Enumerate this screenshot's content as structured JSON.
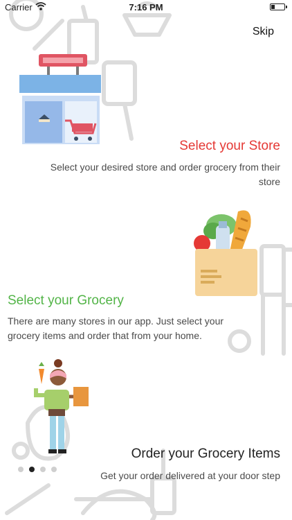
{
  "status_bar": {
    "carrier": "Carrier",
    "time": "7:16 PM",
    "wifi_icon": "wifi-icon",
    "battery_icon": "battery-icon"
  },
  "skip_label": "Skip",
  "sections": [
    {
      "title": "Select your Store",
      "description": "Select your desired store and order grocery from their store",
      "illustration": "store-illustration",
      "title_color": "#e53935"
    },
    {
      "title": "Select your Grocery",
      "description": "There are many stores in our app. Just select your grocery items and order that from your home.",
      "illustration": "grocery-bag-illustration",
      "title_color": "#52b447"
    },
    {
      "title": "Order your Grocery Items",
      "description": "Get your order delivered at your door step",
      "illustration": "shopper-illustration",
      "title_color": "#222222"
    }
  ],
  "page_indicator": {
    "count": 4,
    "active_index": 1
  },
  "colors": {
    "accent_red": "#e53935",
    "accent_green": "#52b447",
    "doodle_gray": "#dcdcdc"
  }
}
